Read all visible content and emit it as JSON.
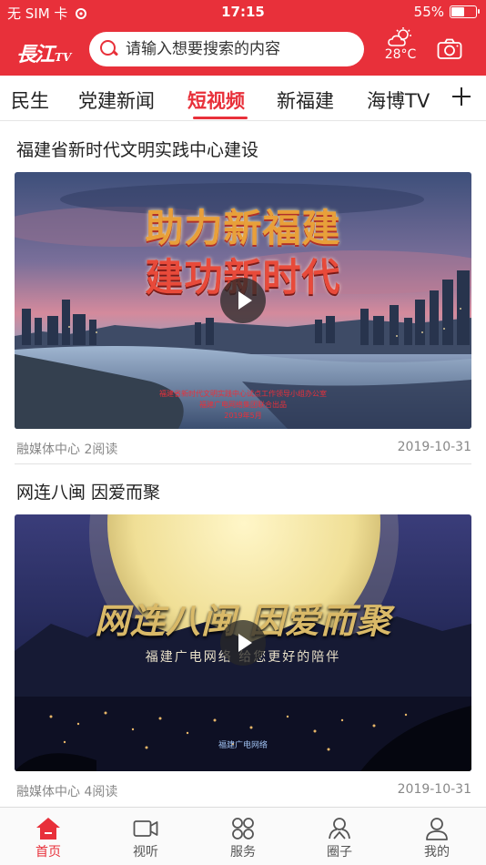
{
  "status_bar": {
    "carrier": "无 SIM 卡",
    "time": "17:15",
    "battery_percent": "55%",
    "battery_level": 0.55
  },
  "header": {
    "logo_text": "長江",
    "logo_suffix": "TV",
    "search_placeholder": "请输入想要搜索的内容",
    "weather_temp": "28°C",
    "weather_icon": "partly-cloudy-icon",
    "camera_icon": "camera-icon",
    "accent_color": "#e8303a"
  },
  "tabs": [
    {
      "label": "民生",
      "active": false
    },
    {
      "label": "党建新闻",
      "active": false
    },
    {
      "label": "短视频",
      "active": true
    },
    {
      "label": "新福建",
      "active": false
    },
    {
      "label": "海博TV",
      "active": false
    }
  ],
  "articles": [
    {
      "title": "福建省新时代文明实践中心建设",
      "overlay_line1": "助力新福建",
      "overlay_line2": "建功新时代",
      "caption_line1": "福建省新时代文明实践中心试点工作领导小组办公室",
      "caption_line2": "福建广电网络集团联合出品",
      "caption_line3": "2019年5月",
      "source": "融媒体中心",
      "reads": "2阅读",
      "date": "2019-10-31"
    },
    {
      "title": "网连八闽 因爱而聚",
      "overlay_line1": "网连八闽 因爱而聚",
      "overlay_line2": "福建广电网络 给您更好的陪伴",
      "watermark": "福建广电网络",
      "source": "融媒体中心",
      "reads": "4阅读",
      "date": "2019-10-31"
    }
  ],
  "bottom_nav": [
    {
      "label": "首页",
      "icon": "home-icon",
      "active": true
    },
    {
      "label": "视听",
      "icon": "video-camera-icon",
      "active": false
    },
    {
      "label": "服务",
      "icon": "grid-icon",
      "active": false
    },
    {
      "label": "圈子",
      "icon": "community-icon",
      "active": false
    },
    {
      "label": "我的",
      "icon": "user-icon",
      "active": false
    }
  ]
}
